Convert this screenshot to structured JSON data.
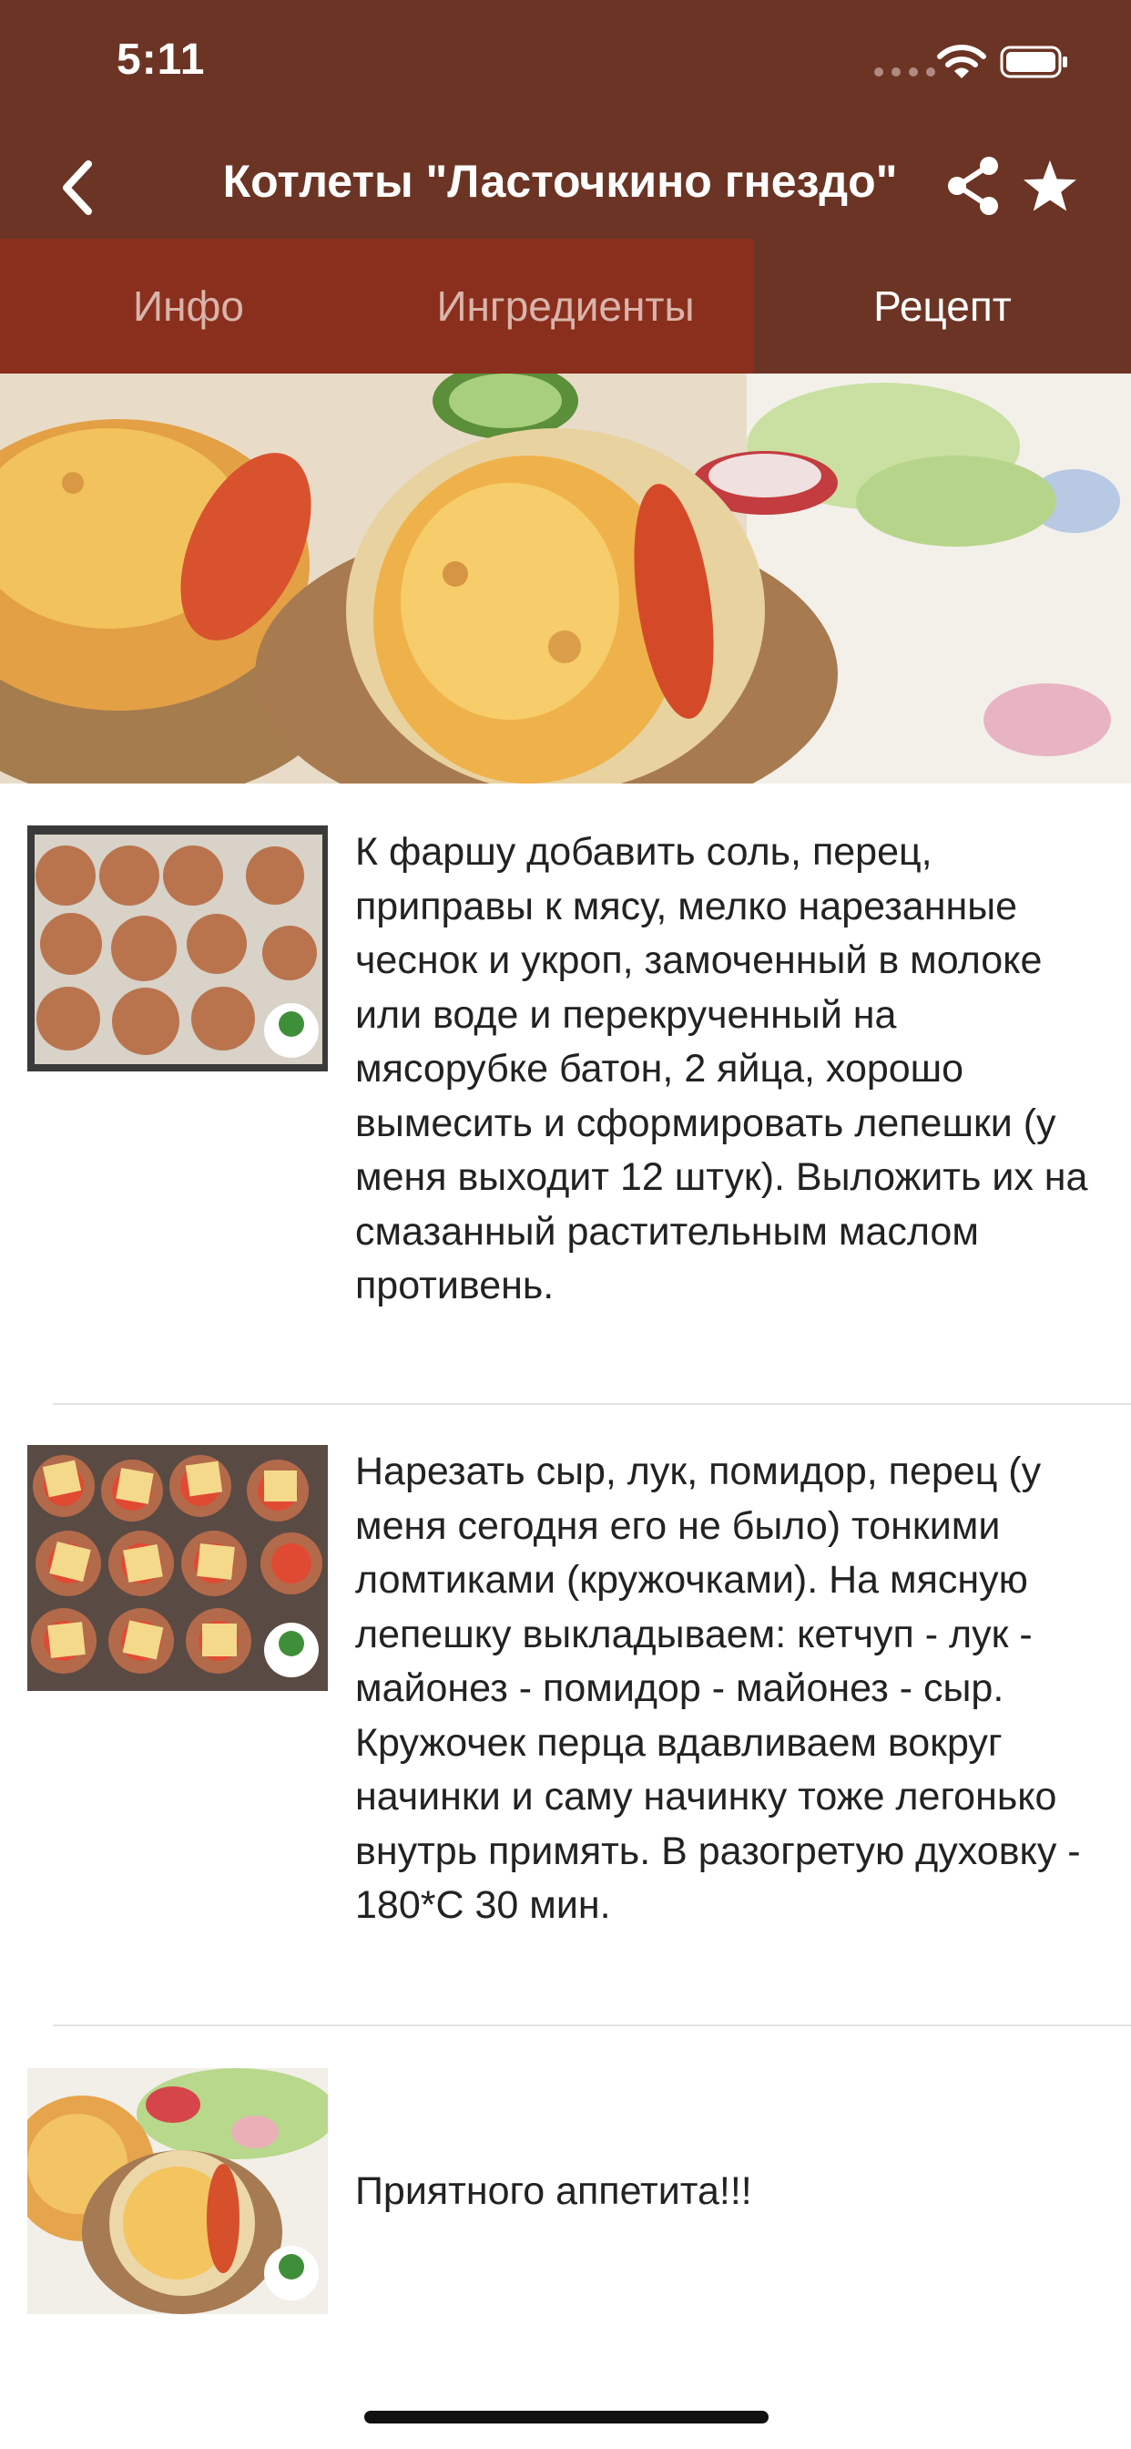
{
  "status_bar": {
    "time": "5:11"
  },
  "nav": {
    "title": "Котлеты \"Ласточкино гнездо\"",
    "back_icon": "chevron-left-icon",
    "share_icon": "share-icon",
    "favorite_icon": "star-icon"
  },
  "tabs": [
    {
      "label": "Инфо",
      "selected": false
    },
    {
      "label": "Ингредиенты",
      "selected": false
    },
    {
      "label": "Рецепт",
      "selected": true
    }
  ],
  "steps": [
    {
      "text": "К фаршу добавить соль, перец, приправы к мясу, мелко нарезанные чеснок и укроп, замоченный в молоке или воде и перекрученный на мясорубке батон, 2 яйца, хорошо вымесить и сформировать лепешки (у меня выходит 12 штук). Выложить их на смазанный растительным маслом противень."
    },
    {
      "text": "Нарезать сыр, лук, помидор, перец (у меня сегодня его не было) тонкими ломтиками (кружочками). На мясную лепешку выкладываем: кетчуп - лук - майонез - помидор - майонез - сыр. Кружочек перца вдавливаем вокруг начинки и саму начинку тоже легонько внутрь примять. В разогретую духовку - 180*С 30 мин."
    },
    {
      "text": "Приятного аппетита!!!"
    }
  ],
  "colors": {
    "header_bg": "#6c3424",
    "tab_bg": "#8a2f1d",
    "tab_selected_text": "#ffffff",
    "tab_unselected_text": "#d9b4aa"
  }
}
